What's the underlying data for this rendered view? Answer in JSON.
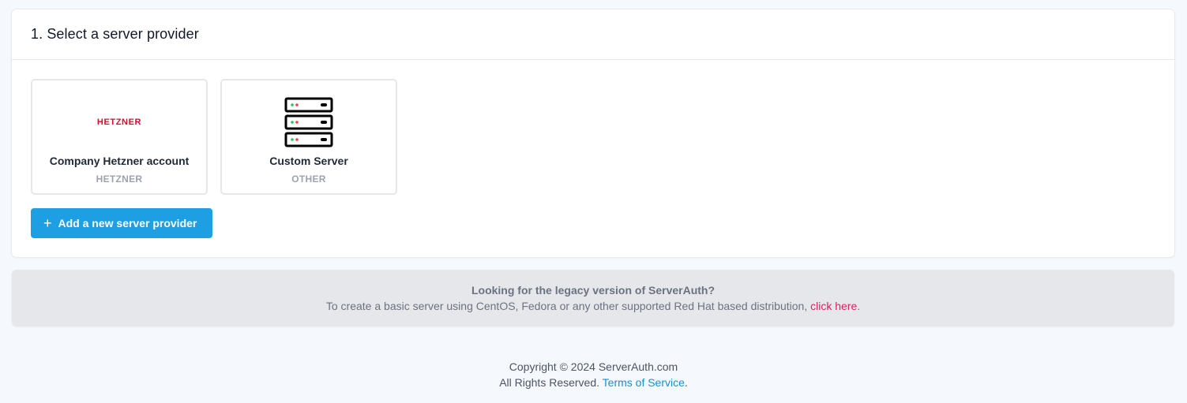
{
  "section": {
    "title": "1. Select a server provider"
  },
  "providers": [
    {
      "name": "Company Hetzner account",
      "type": "HETZNER",
      "logo_text": "HETZNER",
      "logo_color": "#d50c2d"
    },
    {
      "name": "Custom Server",
      "type": "OTHER",
      "icon": "server-rack-icon"
    }
  ],
  "add_button": {
    "label": "Add a new server provider",
    "icon": "plus-icon",
    "color": "#1f9fe3"
  },
  "legacy": {
    "title": "Looking for the legacy version of ServerAuth?",
    "text": "To create a basic server using CentOS, Fedora or any other supported Red Hat based distribution, ",
    "link": "click here",
    "period": "."
  },
  "footer": {
    "copyright": "Copyright © 2024 ServerAuth.com",
    "rights": "All Rights Reserved. ",
    "terms": "Terms of Service",
    "period": "."
  }
}
